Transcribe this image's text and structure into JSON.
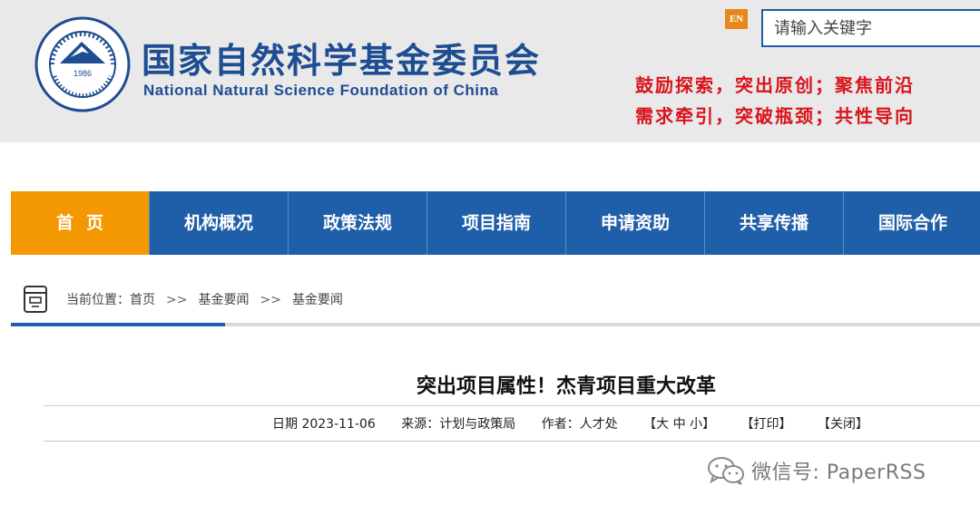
{
  "header": {
    "org_name_cn": "国家自然科学基金委员会",
    "org_name_en": "National Natural Science Foundation of China",
    "logo_year": "1986",
    "en_button": "EN",
    "search_placeholder": "请输入关键字",
    "slogan_line1": "鼓励探索，突出原创；聚焦前沿",
    "slogan_line2": "需求牵引，突破瓶颈；共性导向"
  },
  "nav": {
    "items": [
      {
        "label": "首页"
      },
      {
        "label": "机构概况"
      },
      {
        "label": "政策法规"
      },
      {
        "label": "项目指南"
      },
      {
        "label": "申请资助"
      },
      {
        "label": "共享传播"
      },
      {
        "label": "国际合作"
      }
    ],
    "active_index": 0
  },
  "breadcrumb": {
    "prefix": "当前位置：",
    "items": [
      "首页",
      "基金要闻",
      "基金要闻"
    ],
    "separator": ">>"
  },
  "article": {
    "title": "突出项目属性！杰青项目重大改革",
    "date": "日期 2023-11-06",
    "source": "来源：计划与政策局",
    "author": "作者：人才处",
    "font_size_control": "【大 中 小】",
    "print": "【打印】",
    "close": "【关闭】"
  },
  "watermark": {
    "text": "微信号: PaperRSS"
  },
  "colors": {
    "primary_blue": "#1f5ea8",
    "active_orange": "#f39800",
    "slogan_red": "#d8131b"
  }
}
